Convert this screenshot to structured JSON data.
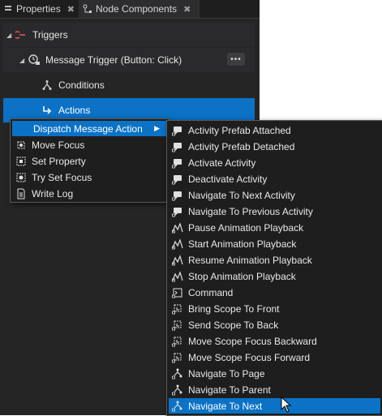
{
  "tabs": [
    {
      "label": "Properties",
      "close": "✖"
    },
    {
      "label": "Node Components",
      "close": "✖"
    }
  ],
  "tree": {
    "triggers_label": "Triggers",
    "message_trigger_label": "Message Trigger (Button: Click)",
    "more_label": "•••",
    "conditions_label": "Conditions",
    "actions_label": "Actions"
  },
  "context_menu": {
    "items": [
      {
        "label": "Dispatch Message Action",
        "icon": "dispatch-icon"
      },
      {
        "label": "Move Focus",
        "icon": "move-focus-icon"
      },
      {
        "label": "Set Property",
        "icon": "set-property-icon"
      },
      {
        "label": "Try Set Focus",
        "icon": "focus-icon"
      },
      {
        "label": "Write Log",
        "icon": "document-icon"
      }
    ]
  },
  "submenu": {
    "items": [
      {
        "label": "Activity Prefab Attached",
        "icon": "activity-icon"
      },
      {
        "label": "Activity Prefab Detached",
        "icon": "activity-icon"
      },
      {
        "label": "Activate Activity",
        "icon": "activity-icon"
      },
      {
        "label": "Deactivate Activity",
        "icon": "activity-icon"
      },
      {
        "label": "Navigate To Next Activity",
        "icon": "activity-icon"
      },
      {
        "label": "Navigate To Previous Activity",
        "icon": "activity-icon"
      },
      {
        "label": "Pause Animation Playback",
        "icon": "animation-icon"
      },
      {
        "label": "Start Animation Playback",
        "icon": "animation-icon"
      },
      {
        "label": "Resume Animation Playback",
        "icon": "animation-icon"
      },
      {
        "label": "Stop Animation Playback",
        "icon": "animation-icon"
      },
      {
        "label": "Command",
        "icon": "command-icon"
      },
      {
        "label": "Bring Scope To Front",
        "icon": "scope-icon"
      },
      {
        "label": "Send Scope To Back",
        "icon": "scope-icon"
      },
      {
        "label": "Move Scope Focus Backward",
        "icon": "scope-icon"
      },
      {
        "label": "Move Scope Focus Forward",
        "icon": "scope-icon"
      },
      {
        "label": "Navigate To Page",
        "icon": "navigation-icon"
      },
      {
        "label": "Navigate To Parent",
        "icon": "navigation-icon"
      },
      {
        "label": "Navigate To Next",
        "icon": "navigation-icon"
      }
    ]
  },
  "colors": {
    "accent": "#0b72c6",
    "panel": "#252526",
    "menu": "#1e1e1e"
  }
}
